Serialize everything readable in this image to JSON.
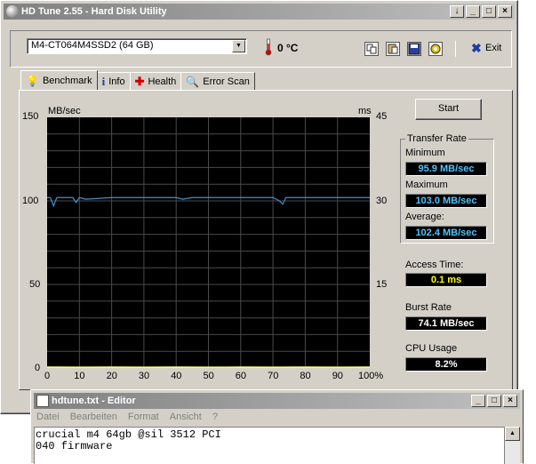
{
  "window": {
    "title": "HD Tune 2.55 - Hard Disk Utility",
    "buttons": [
      "↓",
      "_",
      "□",
      "×"
    ]
  },
  "toolbar": {
    "drive": "M4-CT064M4SSD2 (64 GB)",
    "temperature": "0 °C",
    "exit_label": "Exit",
    "icons": [
      "copy-icon",
      "paste-icon",
      "save-icon",
      "options-icon"
    ]
  },
  "tabs": [
    {
      "label": "Benchmark",
      "icon": "benchmark-icon",
      "active": true
    },
    {
      "label": "Info",
      "icon": "info-icon"
    },
    {
      "label": "Health",
      "icon": "health-cross-icon"
    },
    {
      "label": "Error Scan",
      "icon": "magnifier-icon"
    }
  ],
  "start_label": "Start",
  "transfer": {
    "group_title": "Transfer Rate",
    "min_label": "Minimum",
    "min": "95.9 MB/sec",
    "max_label": "Maximum",
    "max": "103.0 MB/sec",
    "avg_label": "Average:",
    "avg": "102.4 MB/sec"
  },
  "access": {
    "label": "Access Time:",
    "value": "0.1 ms"
  },
  "burst": {
    "label": "Burst Rate",
    "value": "74.1 MB/sec"
  },
  "cpu": {
    "label": "CPU Usage",
    "value": "8.2%"
  },
  "chart_data": {
    "type": "line",
    "ylabel": "MB/sec",
    "y2label": "ms",
    "yticks": [
      "150",
      "100",
      "50",
      "0"
    ],
    "y2ticks": [
      "45",
      "30",
      "15"
    ],
    "xticks": [
      "0",
      "10",
      "20",
      "30",
      "40",
      "50",
      "60",
      "70",
      "80",
      "90",
      "100%"
    ],
    "ylim": [
      0,
      150
    ],
    "xlim": [
      0,
      100
    ],
    "grid": true,
    "series": [
      {
        "color": "#3f8fd2",
        "x": [
          0,
          1,
          2,
          3,
          5,
          8,
          9,
          10,
          12,
          20,
          30,
          40,
          42,
          45,
          50,
          60,
          70,
          72,
          73,
          74,
          76,
          80,
          90,
          100
        ],
        "y": [
          102,
          102,
          97,
          102,
          102,
          102,
          99,
          102,
          101,
          102,
          102,
          102,
          101,
          102,
          102,
          102,
          102,
          100,
          98,
          102,
          102,
          102,
          102,
          102
        ]
      },
      {
        "color": "#ffff66",
        "x": [
          0,
          10,
          20,
          30,
          40,
          50,
          60,
          70,
          80,
          90,
          100
        ],
        "y": [
          0.4,
          0.3,
          0.4,
          0.3,
          0.4,
          0.3,
          0.4,
          0.3,
          0.4,
          0.3,
          0.4
        ]
      }
    ]
  },
  "editor": {
    "title": "hdtune.txt - Editor",
    "buttons": [
      "_",
      "□",
      "×"
    ],
    "menu": [
      "Datei",
      "Bearbeiten",
      "Format",
      "Ansicht",
      "?"
    ],
    "text": "crucial m4 64gb @sil 3512 PCI\n040 firmware"
  }
}
